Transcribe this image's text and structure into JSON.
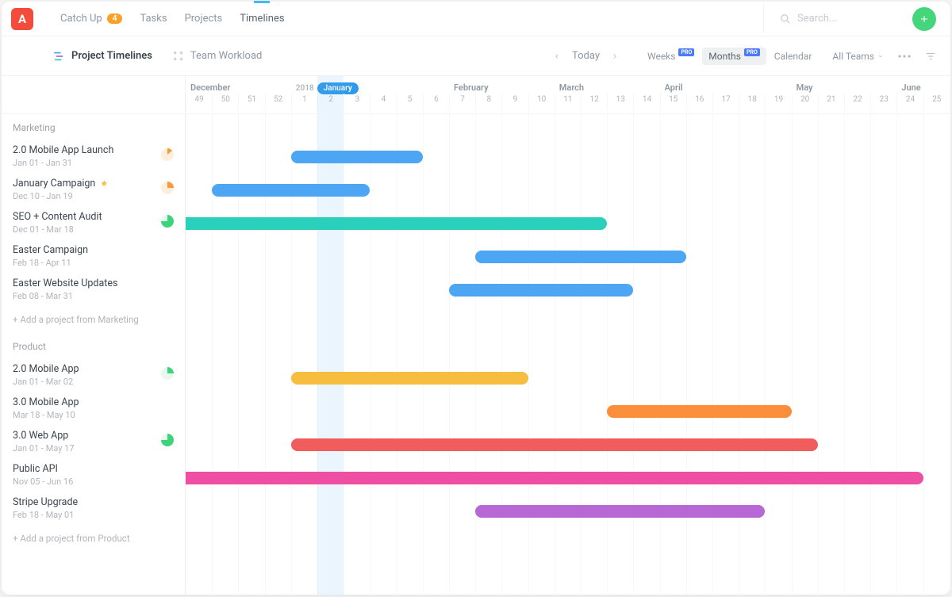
{
  "nav": {
    "catch_up": "Catch Up",
    "catch_up_count": "4",
    "tasks": "Tasks",
    "projects": "Projects",
    "timelines": "Timelines",
    "search_placeholder": "Search...",
    "logo": "A"
  },
  "subnav": {
    "project_timelines": "Project Timelines",
    "team_workload": "Team Workload",
    "today": "Today",
    "weeks": "Weeks",
    "months": "Months",
    "calendar": "Calendar",
    "pro": "PRO",
    "all_teams": "All Teams"
  },
  "timeline": {
    "year": "2018",
    "current_month": "January",
    "months": [
      {
        "label": "December",
        "col": 0
      },
      {
        "label": "February",
        "col": 10
      },
      {
        "label": "March",
        "col": 14
      },
      {
        "label": "April",
        "col": 18
      },
      {
        "label": "May",
        "col": 23
      },
      {
        "label": "June",
        "col": 27
      }
    ],
    "weeks": [
      "49",
      "50",
      "51",
      "52",
      "1",
      "2",
      "3",
      "4",
      "5",
      "6",
      "7",
      "8",
      "9",
      "10",
      "11",
      "12",
      "13",
      "14",
      "15",
      "16",
      "17",
      "18",
      "19",
      "20",
      "21",
      "22",
      "23",
      "24",
      "25"
    ],
    "current_week_idx": 5
  },
  "groups": [
    {
      "name": "Marketing",
      "add_label": "+ Add a project from Marketing",
      "projects": [
        {
          "name": "2.0 Mobile App Launch",
          "dates": "Jan 01 - Jan 31",
          "status": "partial-orange",
          "bar": {
            "start": 4,
            "end": 9,
            "color": "#4da6f3"
          }
        },
        {
          "name": "January Campaign",
          "dates": "Dec 10 - Jan 19",
          "star": true,
          "status": "partial-orange2",
          "bar": {
            "start": 1,
            "end": 7,
            "color": "#4da6f3"
          }
        },
        {
          "name": "SEO + Content Audit",
          "dates": "Dec 01 - Mar 18",
          "status": "green",
          "bar": {
            "start": 0,
            "end": 16,
            "color": "#2ad0bb",
            "square_start": true
          }
        },
        {
          "name": "Easter Campaign",
          "dates": "Feb 18 - Apr 11",
          "status": "none",
          "bar": {
            "start": 11,
            "end": 19,
            "color": "#4da6f3"
          }
        },
        {
          "name": "Easter Website Updates",
          "dates": "Feb 08 - Mar 31",
          "status": "none",
          "bar": {
            "start": 10,
            "end": 17,
            "color": "#4da6f3"
          }
        }
      ]
    },
    {
      "name": "Product",
      "add_label": "+ Add a project from Product",
      "projects": [
        {
          "name": "2.0 Mobile App",
          "dates": "Jan 01 - Mar 02",
          "status": "partial-green",
          "bar": {
            "start": 4,
            "end": 13,
            "color": "#f7bd3f"
          }
        },
        {
          "name": "3.0 Mobile App",
          "dates": "Mar 18 - May 10",
          "status": "none",
          "bar": {
            "start": 16,
            "end": 23,
            "color": "#fb8e3b"
          }
        },
        {
          "name": "3.0 Web App",
          "dates": "Jan 01 - May 17",
          "status": "green",
          "bar": {
            "start": 4,
            "end": 24,
            "color": "#f15d5c"
          }
        },
        {
          "name": "Public API",
          "dates": "Nov 05 - Jun 16",
          "status": "none",
          "bar": {
            "start": 0,
            "end": 28,
            "color": "#ee4fa3",
            "square_start": true
          }
        },
        {
          "name": "Stripe Upgrade",
          "dates": "Feb 18 - May 01",
          "status": "none",
          "bar": {
            "start": 11,
            "end": 22,
            "color": "#b768d4"
          }
        }
      ]
    }
  ],
  "chart_data": {
    "type": "gantt",
    "title": "Project Timelines",
    "x_unit": "iso_week",
    "weeks": [
      "2017-W49",
      "2017-W50",
      "2017-W51",
      "2017-W52",
      "2018-W01",
      "2018-W02",
      "2018-W03",
      "2018-W04",
      "2018-W05",
      "2018-W06",
      "2018-W07",
      "2018-W08",
      "2018-W09",
      "2018-W10",
      "2018-W11",
      "2018-W12",
      "2018-W13",
      "2018-W14",
      "2018-W15",
      "2018-W16",
      "2018-W17",
      "2018-W18",
      "2018-W19",
      "2018-W20",
      "2018-W21",
      "2018-W22",
      "2018-W23",
      "2018-W24",
      "2018-W25"
    ],
    "tasks": [
      {
        "group": "Marketing",
        "name": "2.0 Mobile App Launch",
        "start": "2018-01-01",
        "end": "2018-01-31",
        "color": "#4da6f3"
      },
      {
        "group": "Marketing",
        "name": "January Campaign",
        "start": "2017-12-10",
        "end": "2018-01-19",
        "color": "#4da6f3"
      },
      {
        "group": "Marketing",
        "name": "SEO + Content Audit",
        "start": "2017-12-01",
        "end": "2018-03-18",
        "color": "#2ad0bb"
      },
      {
        "group": "Marketing",
        "name": "Easter Campaign",
        "start": "2018-02-18",
        "end": "2018-04-11",
        "color": "#4da6f3"
      },
      {
        "group": "Marketing",
        "name": "Easter Website Updates",
        "start": "2018-02-08",
        "end": "2018-03-31",
        "color": "#4da6f3"
      },
      {
        "group": "Product",
        "name": "2.0 Mobile App",
        "start": "2018-01-01",
        "end": "2018-03-02",
        "color": "#f7bd3f"
      },
      {
        "group": "Product",
        "name": "3.0 Mobile App",
        "start": "2018-03-18",
        "end": "2018-05-10",
        "color": "#fb8e3b"
      },
      {
        "group": "Product",
        "name": "3.0 Web App",
        "start": "2018-01-01",
        "end": "2018-05-17",
        "color": "#f15d5c"
      },
      {
        "group": "Product",
        "name": "Public API",
        "start": "2017-11-05",
        "end": "2018-06-16",
        "color": "#ee4fa3"
      },
      {
        "group": "Product",
        "name": "Stripe Upgrade",
        "start": "2018-02-18",
        "end": "2018-05-01",
        "color": "#b768d4"
      }
    ]
  }
}
